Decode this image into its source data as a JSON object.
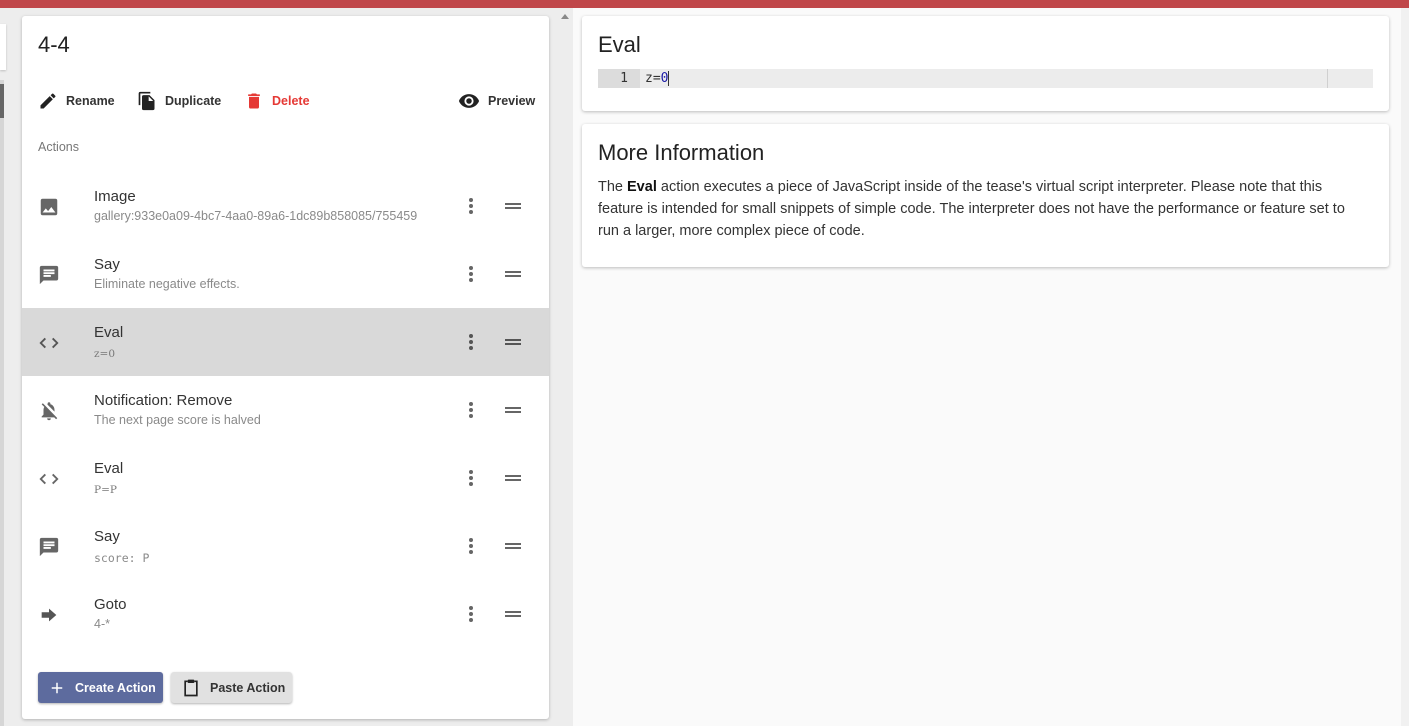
{
  "page": {
    "title": "4-4"
  },
  "toolbar": {
    "rename": "Rename",
    "duplicate": "Duplicate",
    "delete": "Delete",
    "preview": "Preview"
  },
  "actions_label": "Actions",
  "actions": [
    {
      "icon": "image-icon",
      "title": "Image",
      "subtitle": "gallery:933e0a09-4bc7-4aa0-89a6-1dc89b858085/755459"
    },
    {
      "icon": "message-icon",
      "title": "Say",
      "subtitle": "Eliminate negative effects."
    },
    {
      "icon": "code-icon",
      "title": "Eval",
      "subtitle": "z=0",
      "selected": true
    },
    {
      "icon": "notifications-off-icon",
      "title": "Notification: Remove",
      "subtitle": "The next page score is halved"
    },
    {
      "icon": "code-icon",
      "title": "Eval",
      "subtitle": "P=P"
    },
    {
      "icon": "message-icon",
      "title": "Say",
      "subtitle": "score: P"
    },
    {
      "icon": "arrow-forward-icon",
      "title": "Goto",
      "subtitle": "4-*"
    }
  ],
  "buttons": {
    "create": "Create Action",
    "paste": "Paste Action"
  },
  "eval_card": {
    "title": "Eval",
    "line_number": "1",
    "code_var": "z=",
    "code_num": "0"
  },
  "info_card": {
    "title": "More Information",
    "text_before": "The ",
    "text_bold": "Eval",
    "text_after": " action executes a piece of JavaScript inside of the tease's virtual script interpreter. Please note that this feature is intended for small snippets of simple code. The interpreter does not have the performance or feature set to run a larger, more complex piece of code."
  },
  "colors": {
    "topbar": "#c0474a",
    "primary": "#5d6b9e",
    "danger": "#e53935",
    "selected_row": "#d9d9d9"
  }
}
